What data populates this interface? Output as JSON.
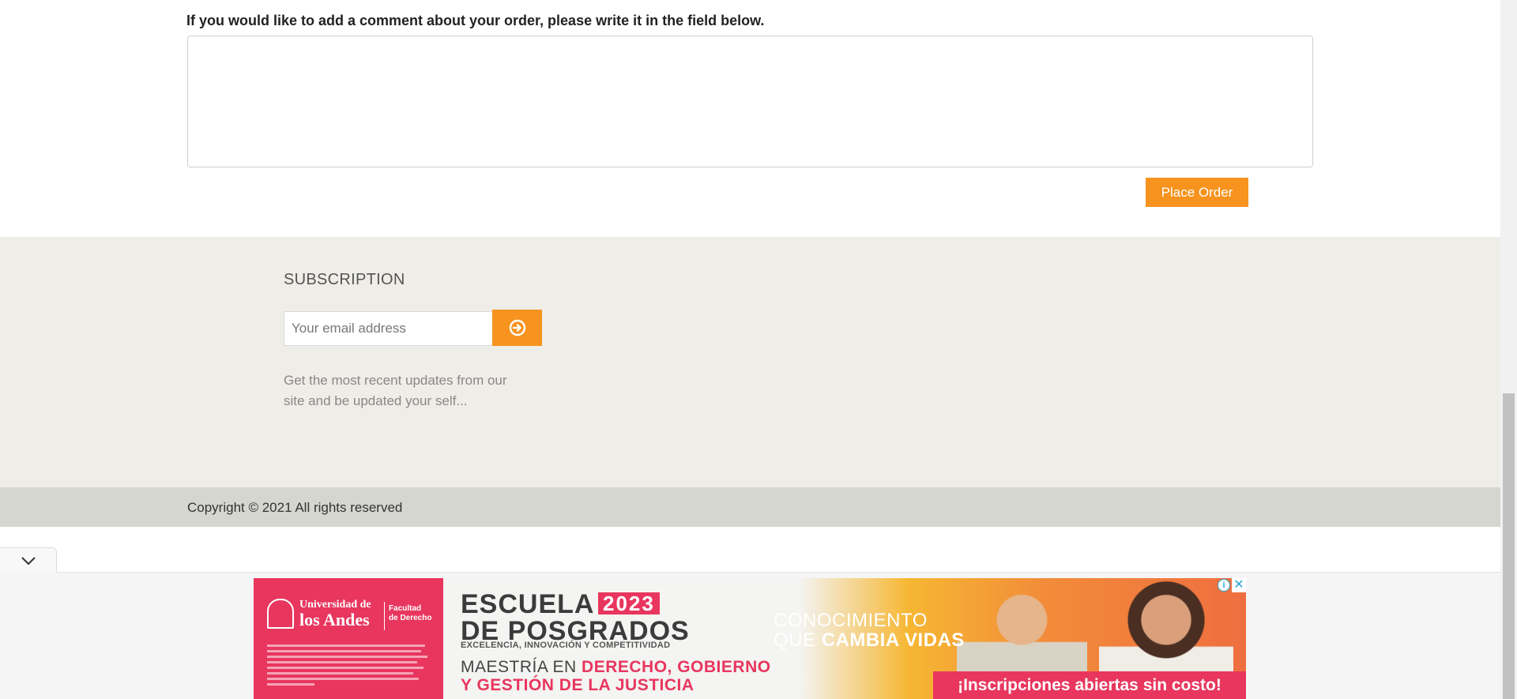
{
  "comment": {
    "label": "If you would like to add a comment about your order, please write it in the field below.",
    "value": "",
    "place_order_label": "Place Order"
  },
  "subscription": {
    "title": "SUBSCRIPTION",
    "email_placeholder": "Your email address",
    "submit_icon": "circle-arrow-right-icon",
    "description": "Get the most recent updates from our site and be updated your self..."
  },
  "footer": {
    "copyright": "Copyright © 2021 All rights reserved"
  },
  "ad_drawer": {
    "collapse_icon": "chevron-down-icon",
    "ad": {
      "logo_line1": "Universidad de",
      "logo_line2": "los Andes",
      "logo_faculty_1": "Facultad",
      "logo_faculty_2": "de Derecho",
      "headline_1": "ESCUELA",
      "headline_year": "2023",
      "headline_2": "DE POSGRADOS",
      "tagline": "EXCELENCIA, INNOVACIÓN Y COMPETITIVIDAD",
      "program_prefix": "MAESTRÍA EN",
      "program_1": "DERECHO, GOBIERNO",
      "program_2": "Y GESTIÓN DE LA JUSTICIA",
      "slogan_1": "CONOCIMIENTO",
      "slogan_2a": "QUE",
      "slogan_2b": "CAMBIA VIDAS",
      "cta": "¡Inscripciones abiertas sin costo!",
      "info_icon": "info-icon",
      "close_icon": "close-icon"
    }
  },
  "colors": {
    "accent": "#f7931e",
    "footer_bg": "#efede7",
    "footer_bottom_bg": "#d6d6d0",
    "ad_pink": "#e8365e"
  }
}
